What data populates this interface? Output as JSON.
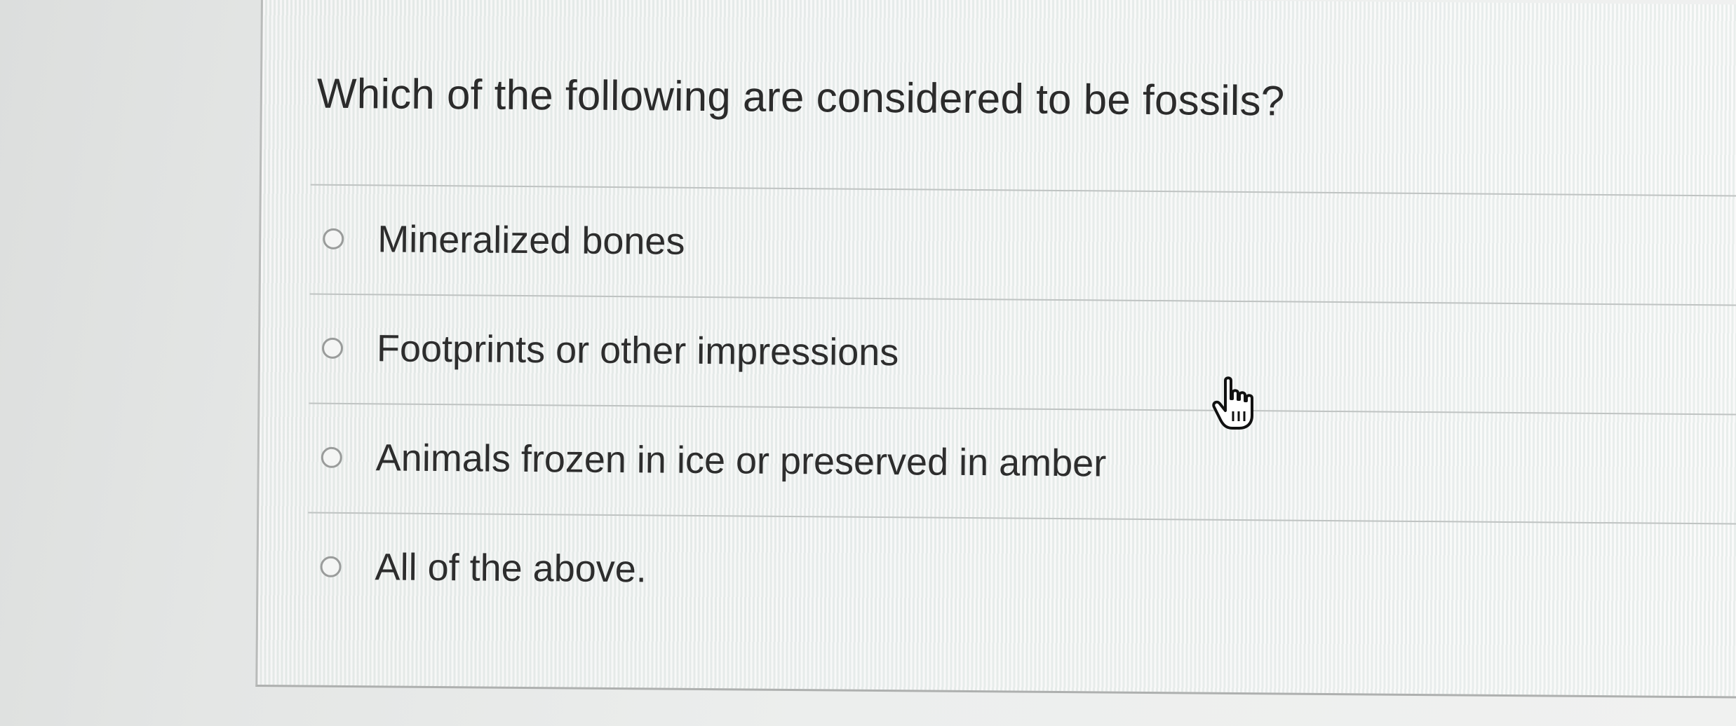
{
  "question": {
    "text": "Which of the following are considered to be fossils?"
  },
  "options": [
    {
      "label": "Mineralized bones",
      "selected": false
    },
    {
      "label": "Footprints or other impressions",
      "selected": false
    },
    {
      "label": "Animals frozen in ice or preserved in amber",
      "selected": false
    },
    {
      "label": "All of the above.",
      "selected": false
    }
  ],
  "cursor": {
    "icon": "hand-pointer-icon"
  }
}
